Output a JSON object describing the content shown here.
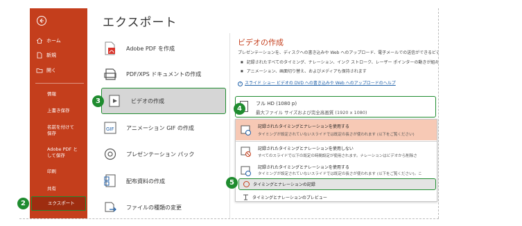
{
  "sidebar": {
    "back_icon": "back-arrow-icon",
    "items": [
      {
        "label": "ホーム",
        "icon": "home-icon"
      },
      {
        "label": "新規",
        "icon": "new-file-icon"
      },
      {
        "label": "開く",
        "icon": "folder-open-icon"
      }
    ],
    "sub_items": [
      {
        "label": "情報"
      },
      {
        "label": "上書き保存"
      },
      {
        "label": "名前を付けて保存"
      },
      {
        "label": "Adobe PDF として保存"
      },
      {
        "label": "印刷"
      },
      {
        "label": "共有"
      },
      {
        "label": "エクスポート"
      }
    ],
    "selected_label": "エクスポート"
  },
  "main": {
    "title": "エクスポート",
    "menu": [
      {
        "label": "Adobe PDF を作成",
        "icon": "adobe-pdf-icon"
      },
      {
        "label": "PDF/XPS ドキュメントの作成",
        "icon": "pdf-xps-icon"
      },
      {
        "label": "ビデオの作成",
        "icon": "video-icon"
      },
      {
        "label": "アニメーション GIF の作成",
        "icon": "gif-icon"
      },
      {
        "label": "プレゼンテーション パック",
        "icon": "package-icon"
      },
      {
        "label": "配布資料の作成",
        "icon": "handout-icon"
      },
      {
        "label": "ファイルの種類の変更",
        "icon": "change-filetype-icon"
      }
    ]
  },
  "panel": {
    "title": "ビデオの作成",
    "description": "プレゼンテーションを、ディスクへの書き込みや Web へのアップロード、電子メールでの送信ができるビデオ",
    "bullets": [
      "記録されたすべてのタイミング、ナレーション、インク ストローク、レーザー ポインターの動きが組み込",
      "アニメーション、画面切り替え、およびメディアも保持されます"
    ],
    "help_link": "スライド ショー ビデオの DVD への書き込みや Web へのアップロードのヘルプ",
    "quality": {
      "main": "フル HD (1080 p)",
      "sub": "最大ファイル サイズおよび完全高画質 (1920 x 1080)"
    },
    "options": [
      {
        "title": "記録されたタイミングとナレーションを使用する",
        "sub": "タイミングが設定されていないスライドでは既定の長さが使われます (以下をご覧ください)"
      },
      {
        "title": "記録されたタイミングとナレーションを使用しない",
        "sub": "すべてのスライドで以下の既定の時間設定が使用されます。ナレーションはビデオから削除さ"
      },
      {
        "title": "記録されたタイミングとナレーションを使用する",
        "sub": "タイミングが設定されていないスライドでは既定の長さが使われます (以下をご覧ください)。こ"
      }
    ],
    "record_label": "タイミングとナレーションの記録",
    "preview_label": "タイミングとナレーションのプレビュー"
  },
  "badges": [
    "2",
    "3",
    "4",
    "5"
  ],
  "colors": {
    "accent": "#c43e1c",
    "highlight_border": "#1f8c2f",
    "link": "#1c5ea8"
  }
}
